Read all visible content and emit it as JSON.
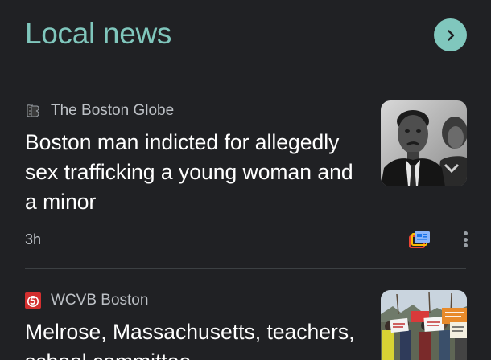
{
  "section": {
    "title": "Local news"
  },
  "articles": [
    {
      "source": "The Boston Globe",
      "source_icon": "boston-globe-logo-icon",
      "headline": "Boston man indicted for allegedly sex trafficking a young woman and a minor",
      "time": "3h",
      "thumbnail": "black-and-white-portrait-photo"
    },
    {
      "source": "WCVB Boston",
      "source_icon": "wcvb-5-logo-icon",
      "headline": "Melrose, Massachusetts, teachers, school committee",
      "thumbnail": "protest-crowd-with-signs-photo"
    }
  ],
  "colors": {
    "background": "#202124",
    "accent": "#80c7bd",
    "headline_text": "#ffffff",
    "secondary_text": "#bdc1c6",
    "wcvb_red": "#d32f2f"
  }
}
